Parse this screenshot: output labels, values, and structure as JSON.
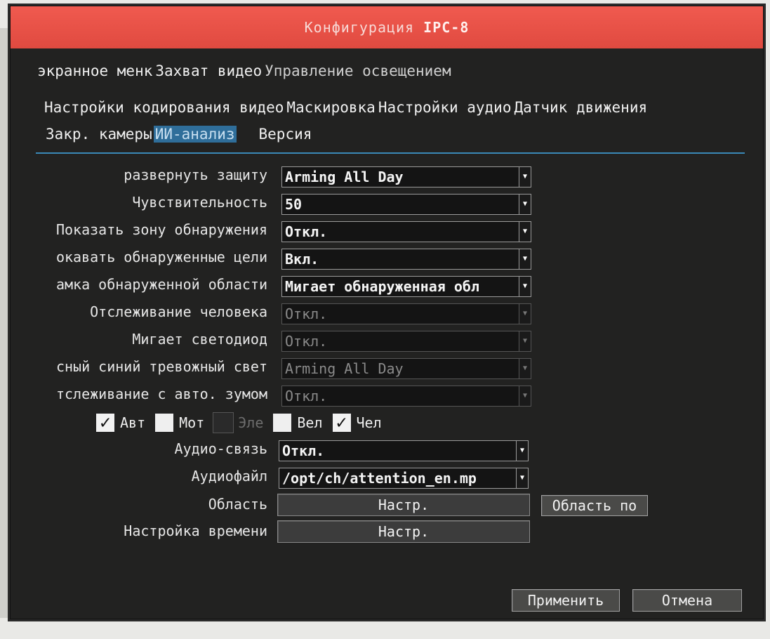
{
  "window": {
    "title_prefix": "Конфигурация",
    "title_model": "IPC-8"
  },
  "tabs": {
    "row1": [
      "экранное менк",
      "Захват видео",
      "Управление освещением"
    ],
    "row2": [
      "Настройки кодирования видео",
      "Маскировка",
      "Настройки аудио",
      "Датчик движения"
    ],
    "row3": [
      "Закр. камеры",
      "ИИ-анализ",
      "Версия"
    ],
    "active": "ИИ-анализ"
  },
  "settings": [
    {
      "label": "развернуть защиту",
      "value": "Arming All Day",
      "enabled": true
    },
    {
      "label": "Чувствительность",
      "value": "50",
      "enabled": true
    },
    {
      "label": "Показать зону обнаружения",
      "value": "Откл.",
      "enabled": true
    },
    {
      "label": "окавать обнаруженные цели",
      "value": "Вкл.",
      "enabled": true
    },
    {
      "label": "амка обнаруженной области",
      "value": "Мигает обнаруженная обл",
      "enabled": true
    },
    {
      "label": "Отслеживание человека",
      "value": "Откл.",
      "enabled": false
    },
    {
      "label": "Мигает светодиод",
      "value": "Откл.",
      "enabled": false
    },
    {
      "label": "сный синий тревожный свет",
      "value": "Arming All Day",
      "enabled": false
    },
    {
      "label": "тслеживание с авто. зумом",
      "value": "Откл.",
      "enabled": false
    }
  ],
  "targets": [
    {
      "label": "Авт",
      "checked": true,
      "enabled": true
    },
    {
      "label": "Мот",
      "checked": false,
      "enabled": true
    },
    {
      "label": "Эле",
      "checked": false,
      "enabled": false
    },
    {
      "label": "Вел",
      "checked": false,
      "enabled": true
    },
    {
      "label": "Чел",
      "checked": true,
      "enabled": true
    }
  ],
  "audio": [
    {
      "label": "Аудио-связь",
      "value": "Откл."
    },
    {
      "label": "Аудиофайл",
      "value": "/opt/ch/attention_en.mp"
    }
  ],
  "area": {
    "label": "Область",
    "button": "Настр.",
    "extra_button": "Область по"
  },
  "schedule": {
    "label": "Настройка времени",
    "button": "Настр."
  },
  "footer": {
    "apply": "Применить",
    "cancel": "Отмена"
  },
  "colors": {
    "title_bar": "#e8524a",
    "panel_bg": "#222221",
    "active_tab": "#2f6e9a",
    "tab_underline": "#3a89b7"
  }
}
